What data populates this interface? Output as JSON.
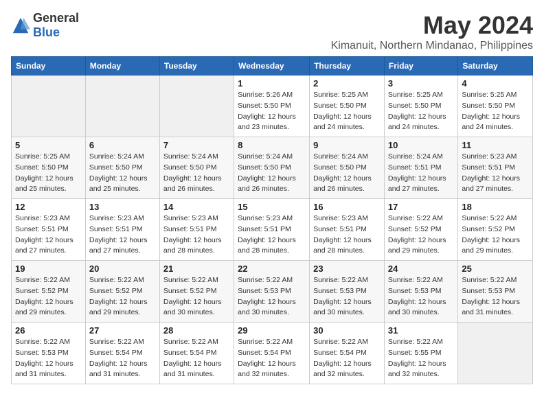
{
  "logo": {
    "general": "General",
    "blue": "Blue"
  },
  "title": "May 2024",
  "location": "Kimanuit, Northern Mindanao, Philippines",
  "weekdays": [
    "Sunday",
    "Monday",
    "Tuesday",
    "Wednesday",
    "Thursday",
    "Friday",
    "Saturday"
  ],
  "weeks": [
    [
      {
        "day": "",
        "sunrise": "",
        "sunset": "",
        "daylight": ""
      },
      {
        "day": "",
        "sunrise": "",
        "sunset": "",
        "daylight": ""
      },
      {
        "day": "",
        "sunrise": "",
        "sunset": "",
        "daylight": ""
      },
      {
        "day": "1",
        "sunrise": "Sunrise: 5:26 AM",
        "sunset": "Sunset: 5:50 PM",
        "daylight": "Daylight: 12 hours and 23 minutes."
      },
      {
        "day": "2",
        "sunrise": "Sunrise: 5:25 AM",
        "sunset": "Sunset: 5:50 PM",
        "daylight": "Daylight: 12 hours and 24 minutes."
      },
      {
        "day": "3",
        "sunrise": "Sunrise: 5:25 AM",
        "sunset": "Sunset: 5:50 PM",
        "daylight": "Daylight: 12 hours and 24 minutes."
      },
      {
        "day": "4",
        "sunrise": "Sunrise: 5:25 AM",
        "sunset": "Sunset: 5:50 PM",
        "daylight": "Daylight: 12 hours and 24 minutes."
      }
    ],
    [
      {
        "day": "5",
        "sunrise": "Sunrise: 5:25 AM",
        "sunset": "Sunset: 5:50 PM",
        "daylight": "Daylight: 12 hours and 25 minutes."
      },
      {
        "day": "6",
        "sunrise": "Sunrise: 5:24 AM",
        "sunset": "Sunset: 5:50 PM",
        "daylight": "Daylight: 12 hours and 25 minutes."
      },
      {
        "day": "7",
        "sunrise": "Sunrise: 5:24 AM",
        "sunset": "Sunset: 5:50 PM",
        "daylight": "Daylight: 12 hours and 26 minutes."
      },
      {
        "day": "8",
        "sunrise": "Sunrise: 5:24 AM",
        "sunset": "Sunset: 5:50 PM",
        "daylight": "Daylight: 12 hours and 26 minutes."
      },
      {
        "day": "9",
        "sunrise": "Sunrise: 5:24 AM",
        "sunset": "Sunset: 5:50 PM",
        "daylight": "Daylight: 12 hours and 26 minutes."
      },
      {
        "day": "10",
        "sunrise": "Sunrise: 5:24 AM",
        "sunset": "Sunset: 5:51 PM",
        "daylight": "Daylight: 12 hours and 27 minutes."
      },
      {
        "day": "11",
        "sunrise": "Sunrise: 5:23 AM",
        "sunset": "Sunset: 5:51 PM",
        "daylight": "Daylight: 12 hours and 27 minutes."
      }
    ],
    [
      {
        "day": "12",
        "sunrise": "Sunrise: 5:23 AM",
        "sunset": "Sunset: 5:51 PM",
        "daylight": "Daylight: 12 hours and 27 minutes."
      },
      {
        "day": "13",
        "sunrise": "Sunrise: 5:23 AM",
        "sunset": "Sunset: 5:51 PM",
        "daylight": "Daylight: 12 hours and 27 minutes."
      },
      {
        "day": "14",
        "sunrise": "Sunrise: 5:23 AM",
        "sunset": "Sunset: 5:51 PM",
        "daylight": "Daylight: 12 hours and 28 minutes."
      },
      {
        "day": "15",
        "sunrise": "Sunrise: 5:23 AM",
        "sunset": "Sunset: 5:51 PM",
        "daylight": "Daylight: 12 hours and 28 minutes."
      },
      {
        "day": "16",
        "sunrise": "Sunrise: 5:23 AM",
        "sunset": "Sunset: 5:51 PM",
        "daylight": "Daylight: 12 hours and 28 minutes."
      },
      {
        "day": "17",
        "sunrise": "Sunrise: 5:22 AM",
        "sunset": "Sunset: 5:52 PM",
        "daylight": "Daylight: 12 hours and 29 minutes."
      },
      {
        "day": "18",
        "sunrise": "Sunrise: 5:22 AM",
        "sunset": "Sunset: 5:52 PM",
        "daylight": "Daylight: 12 hours and 29 minutes."
      }
    ],
    [
      {
        "day": "19",
        "sunrise": "Sunrise: 5:22 AM",
        "sunset": "Sunset: 5:52 PM",
        "daylight": "Daylight: 12 hours and 29 minutes."
      },
      {
        "day": "20",
        "sunrise": "Sunrise: 5:22 AM",
        "sunset": "Sunset: 5:52 PM",
        "daylight": "Daylight: 12 hours and 29 minutes."
      },
      {
        "day": "21",
        "sunrise": "Sunrise: 5:22 AM",
        "sunset": "Sunset: 5:52 PM",
        "daylight": "Daylight: 12 hours and 30 minutes."
      },
      {
        "day": "22",
        "sunrise": "Sunrise: 5:22 AM",
        "sunset": "Sunset: 5:53 PM",
        "daylight": "Daylight: 12 hours and 30 minutes."
      },
      {
        "day": "23",
        "sunrise": "Sunrise: 5:22 AM",
        "sunset": "Sunset: 5:53 PM",
        "daylight": "Daylight: 12 hours and 30 minutes."
      },
      {
        "day": "24",
        "sunrise": "Sunrise: 5:22 AM",
        "sunset": "Sunset: 5:53 PM",
        "daylight": "Daylight: 12 hours and 30 minutes."
      },
      {
        "day": "25",
        "sunrise": "Sunrise: 5:22 AM",
        "sunset": "Sunset: 5:53 PM",
        "daylight": "Daylight: 12 hours and 31 minutes."
      }
    ],
    [
      {
        "day": "26",
        "sunrise": "Sunrise: 5:22 AM",
        "sunset": "Sunset: 5:53 PM",
        "daylight": "Daylight: 12 hours and 31 minutes."
      },
      {
        "day": "27",
        "sunrise": "Sunrise: 5:22 AM",
        "sunset": "Sunset: 5:54 PM",
        "daylight": "Daylight: 12 hours and 31 minutes."
      },
      {
        "day": "28",
        "sunrise": "Sunrise: 5:22 AM",
        "sunset": "Sunset: 5:54 PM",
        "daylight": "Daylight: 12 hours and 31 minutes."
      },
      {
        "day": "29",
        "sunrise": "Sunrise: 5:22 AM",
        "sunset": "Sunset: 5:54 PM",
        "daylight": "Daylight: 12 hours and 32 minutes."
      },
      {
        "day": "30",
        "sunrise": "Sunrise: 5:22 AM",
        "sunset": "Sunset: 5:54 PM",
        "daylight": "Daylight: 12 hours and 32 minutes."
      },
      {
        "day": "31",
        "sunrise": "Sunrise: 5:22 AM",
        "sunset": "Sunset: 5:55 PM",
        "daylight": "Daylight: 12 hours and 32 minutes."
      },
      {
        "day": "",
        "sunrise": "",
        "sunset": "",
        "daylight": ""
      }
    ]
  ]
}
